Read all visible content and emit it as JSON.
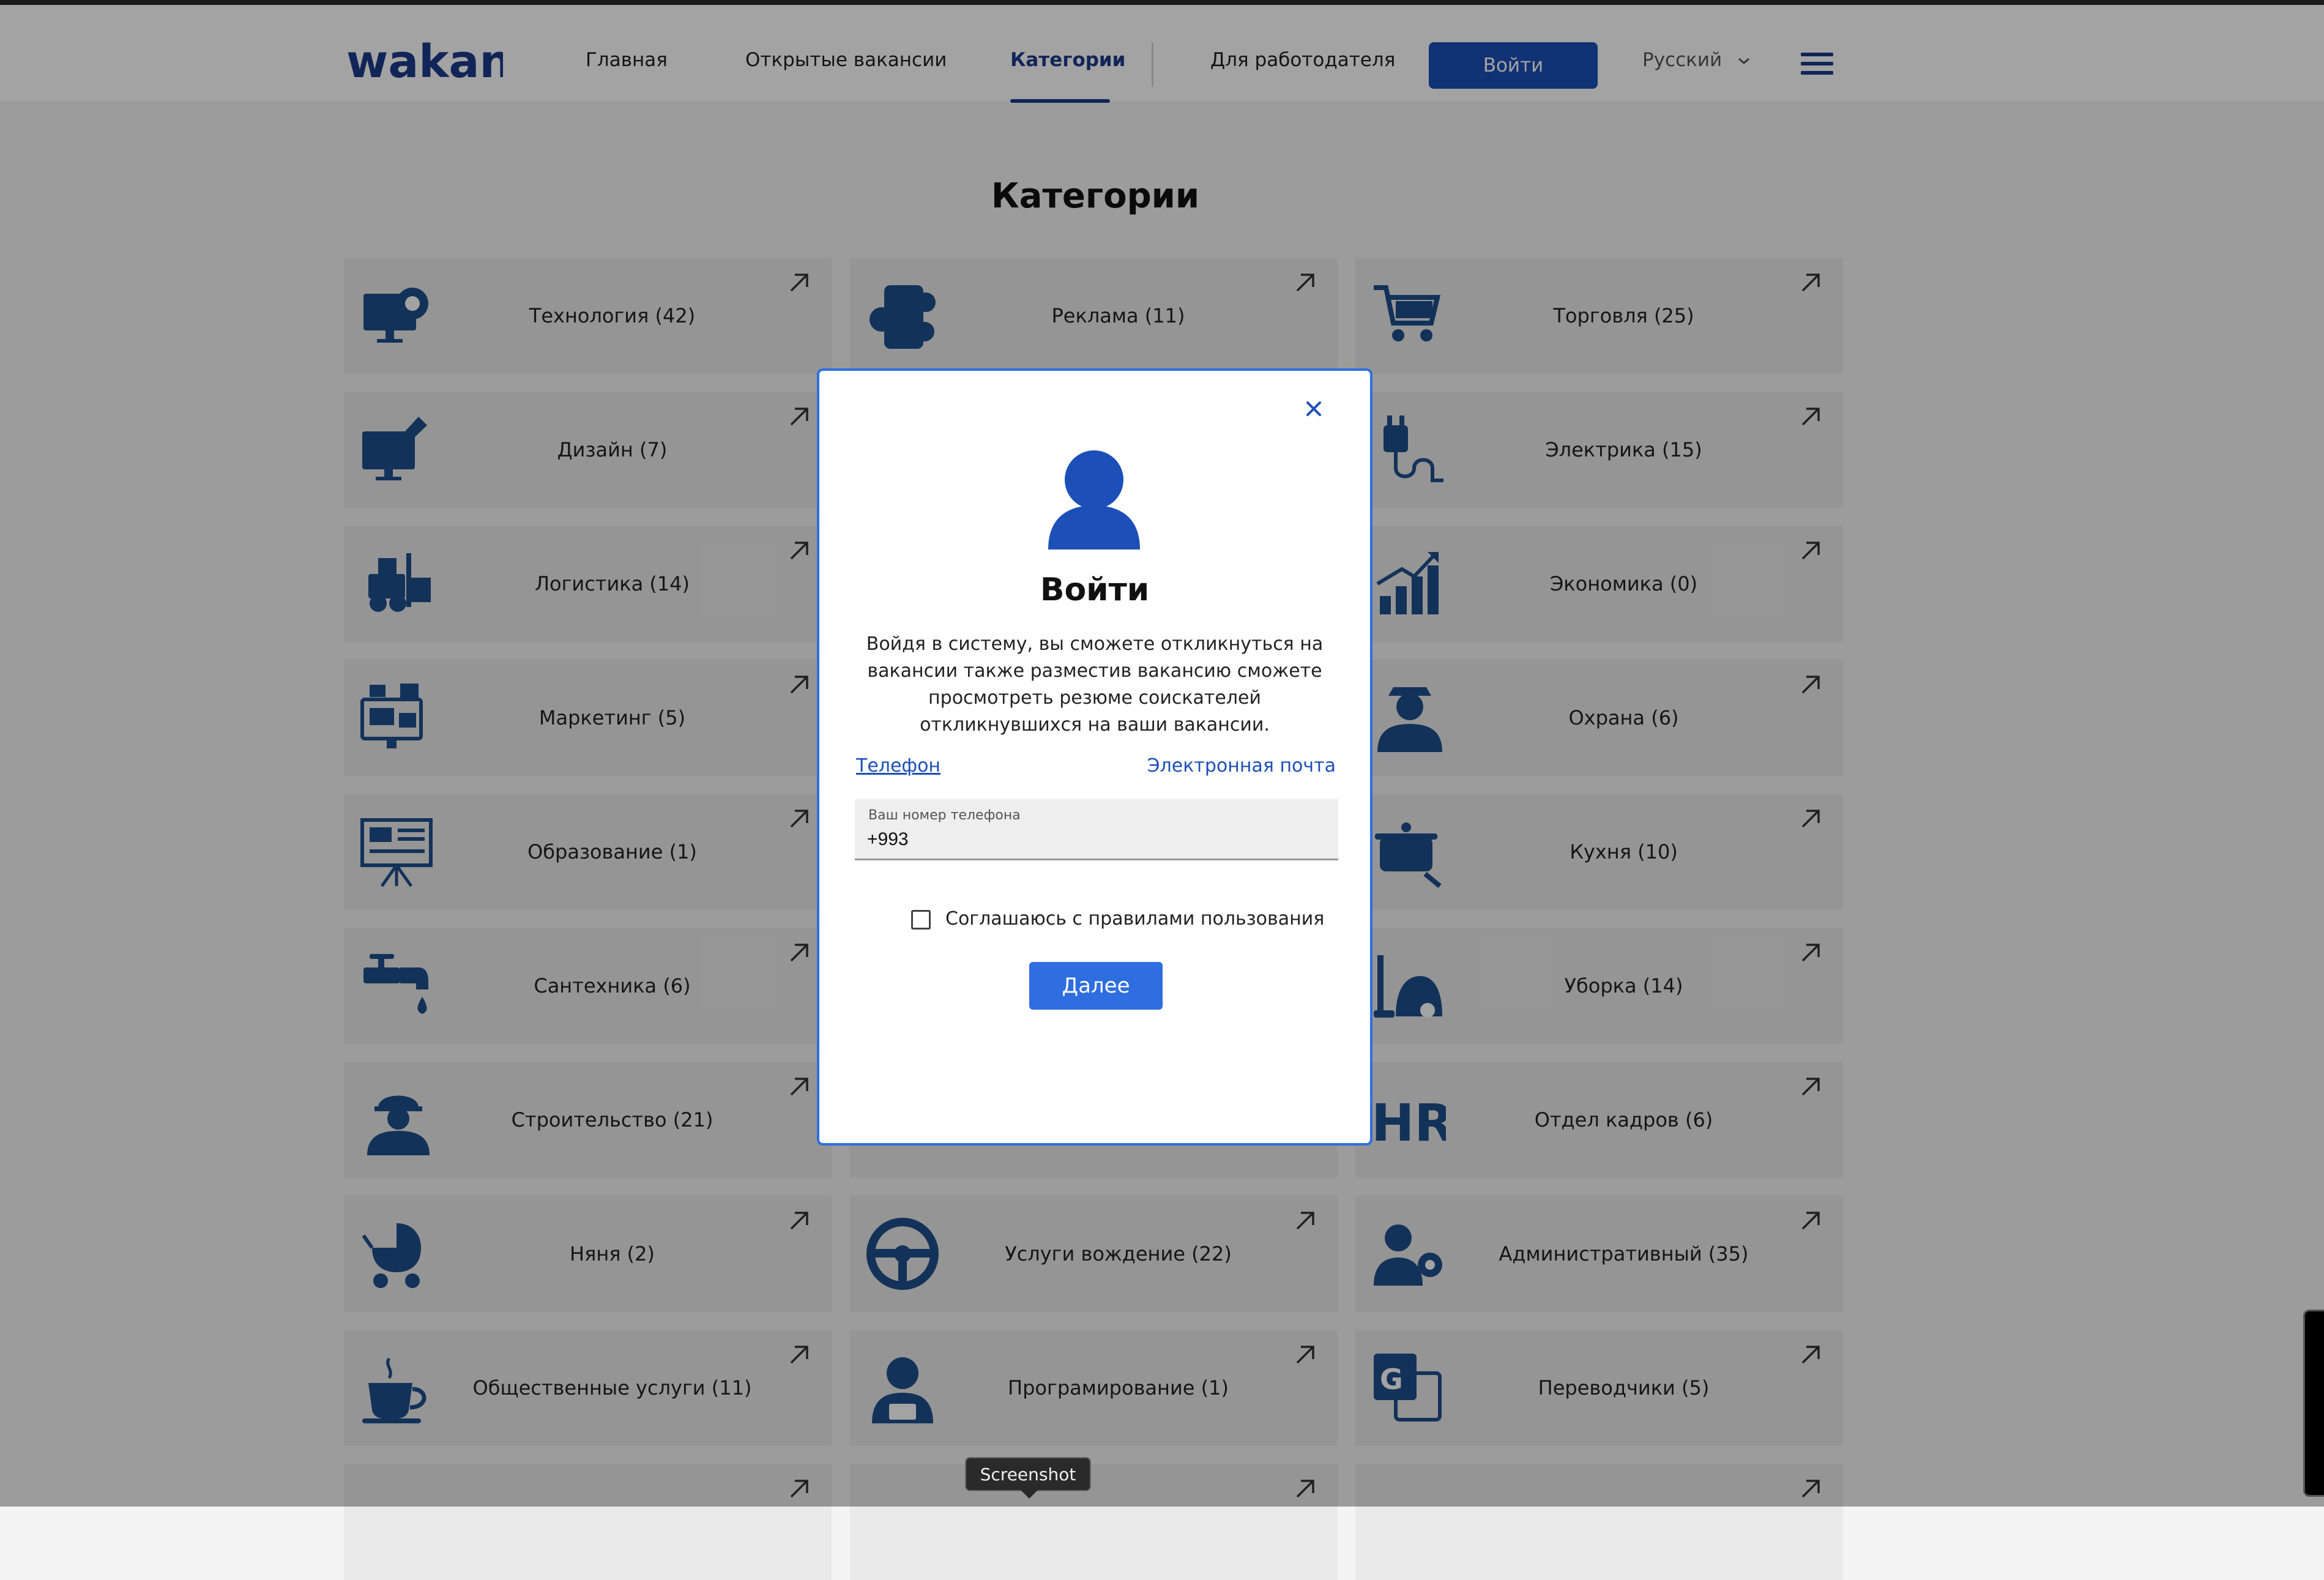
{
  "header": {
    "logo_text": "wakant",
    "nav": [
      "Главная",
      "Открытые вакансии",
      "Категории",
      "Для работодателя"
    ],
    "active_nav": "Категории",
    "login_label": "Войти",
    "language": "Русский"
  },
  "page_title": "Категории",
  "categories": [
    {
      "label": "Технология (42)",
      "icon": "computer-gear-icon"
    },
    {
      "label": "Реклама (11)",
      "icon": "social-media-phone-icon"
    },
    {
      "label": "Торговля (25)",
      "icon": "shopping-cart-icon"
    },
    {
      "label": "Дизайн (7)",
      "icon": "design-monitor-brush-icon"
    },
    {
      "label": "",
      "icon": ""
    },
    {
      "label": "Электрика (15)",
      "icon": "electric-plug-icon"
    },
    {
      "label": "Логистика (14)",
      "icon": "forklift-icon"
    },
    {
      "label": "",
      "icon": ""
    },
    {
      "label": "Экономика (0)",
      "icon": "growth-chart-icon"
    },
    {
      "label": "Маркетинг (5)",
      "icon": "marketing-icon"
    },
    {
      "label": "",
      "icon": ""
    },
    {
      "label": "Охрана (6)",
      "icon": "security-guard-icon"
    },
    {
      "label": "Образование (1)",
      "icon": "presentation-board-icon"
    },
    {
      "label": "",
      "icon": ""
    },
    {
      "label": "Кухня (10)",
      "icon": "cooking-pot-icon"
    },
    {
      "label": "Сантехника (6)",
      "icon": "water-tap-icon"
    },
    {
      "label": "",
      "icon": ""
    },
    {
      "label": "Уборка (14)",
      "icon": "vacuum-cleaner-icon"
    },
    {
      "label": "Строительство (21)",
      "icon": "construction-worker-icon"
    },
    {
      "label": "",
      "icon": ""
    },
    {
      "label": "Отдел кадров (6)",
      "icon": "hr-icon"
    },
    {
      "label": "Няня (2)",
      "icon": "baby-stroller-icon"
    },
    {
      "label": "Услуги вождение (22)",
      "icon": "steering-wheel-icon"
    },
    {
      "label": "Административный (35)",
      "icon": "admin-person-gear-icon"
    },
    {
      "label": "Общественные услуги (11)",
      "icon": "coffee-cup-icon"
    },
    {
      "label": "Програмирование (1)",
      "icon": "programmer-icon"
    },
    {
      "label": "Переводчики (5)",
      "icon": "translate-icon"
    },
    {
      "label": "",
      "icon": ""
    },
    {
      "label": "",
      "icon": ""
    },
    {
      "label": "",
      "icon": ""
    }
  ],
  "modal": {
    "title": "Войти",
    "description": "Войдя в систему, вы сможете откликнуться на вакансии также разместив вакансию сможете просмотреть резюме соискателей откликнувшихся на ваши вакансии.",
    "tab_phone": "Телефон",
    "tab_email": "Электронная почта",
    "phone_label": "Ваш номер телефона",
    "phone_value": "+993",
    "agree_label": "Соглашаюсь с правилами пользования",
    "next_label": "Далее"
  },
  "tooltip": "Screenshot",
  "colors": {
    "brand": "#1b3a8a",
    "button": "#1c4fb8",
    "modal_border": "#2f6ee0",
    "icon": "#1e4f8c"
  }
}
